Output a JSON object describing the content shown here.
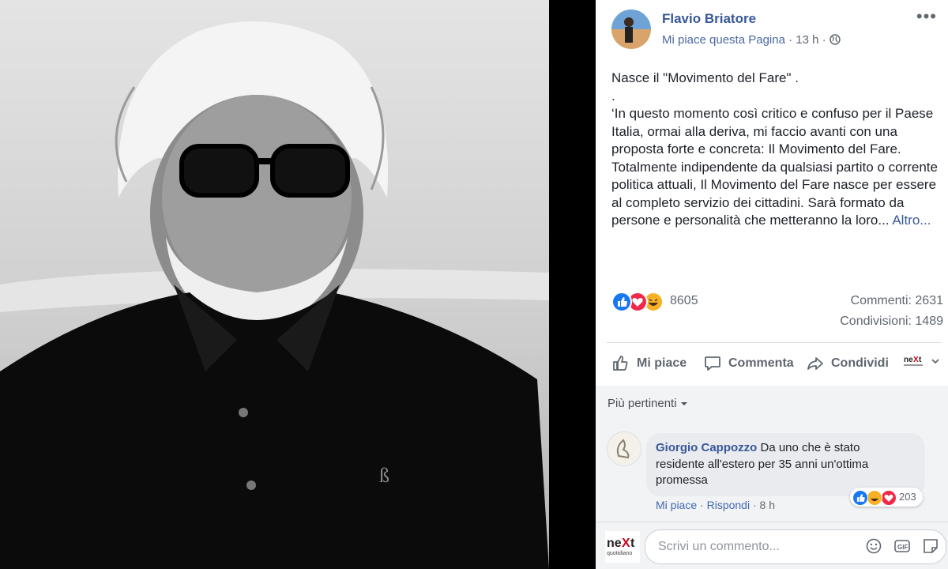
{
  "post": {
    "page_name": "Flavio Briatore",
    "like_page": "Mi piace questa Pagina",
    "meta_dot": "·",
    "time": "13 h",
    "menu": "•••",
    "text": {
      "line1": "Nasce il \"Movimento del Fare\" .",
      "line2": ".",
      "body": "‘In questo momento così critico e confuso per il Paese Italia, ormai alla deriva, mi faccio avanti con una proposta forte e concreta: Il Movimento del Fare. Totalmente indipendente da qualsiasi partito o corrente politica attuali, Il Movimento del Fare nasce per essere al completo servizio dei cittadini. Sarà formato da persone e personalità che metteranno la loro...",
      "more": "Altro..."
    },
    "reactions_count": "8605",
    "comments_count": "Commenti: 2631",
    "shares_count": "Condivisioni: 1489"
  },
  "actions": {
    "like": "Mi piace",
    "comment": "Commenta",
    "share": "Condividi",
    "share_as_logo": "neXt quotidiano"
  },
  "comments": {
    "sort": "Più pertinenti",
    "items": [
      {
        "author": "Giorgio Cappozzo",
        "text": "Da uno che è stato residente all'estero per 35 anni un'ottima promessa",
        "like": "Mi piace",
        "reply": "Rispondi",
        "time": "8 h",
        "reactions": "203"
      }
    ],
    "input_placeholder": "Scrivi un commento...",
    "input_avatar_text": "neXt quotidiano"
  },
  "colors": {
    "link_blue": "#365899",
    "like_blue": "#1877f2",
    "love_red": "#f0284a",
    "haha_yellow": "#f7b125",
    "grey_text": "#606770"
  },
  "icons": [
    "globe-icon",
    "more-options-icon",
    "like-reaction-icon",
    "love-reaction-icon",
    "haha-reaction-icon",
    "thumbs-up-icon",
    "speech-bubble-icon",
    "share-arrow-icon",
    "chevron-down-icon",
    "emoji-icon",
    "gif-icon",
    "sticker-icon"
  ]
}
